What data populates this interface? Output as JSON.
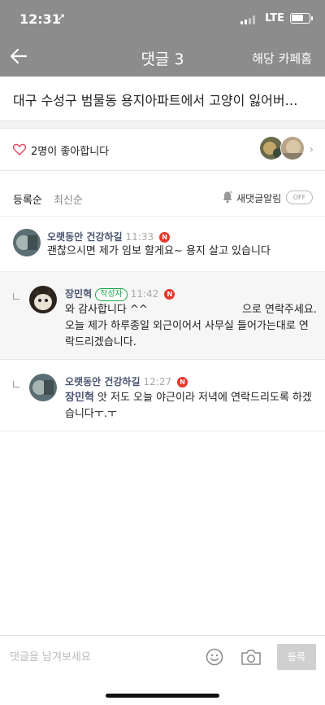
{
  "status_bar": {
    "time": "12:31",
    "network": "LTE"
  },
  "nav": {
    "title": "댓글 3",
    "cafe_home": "해당 카페홈"
  },
  "post": {
    "title": "대구 수성구 범물동 용지아파트에서 고양이 잃어버…"
  },
  "likes": {
    "text": "2명이 좋아합니다"
  },
  "sort": {
    "by_registration": "등록순",
    "latest": "최신순",
    "new_comment_alarm": "새댓글알림",
    "alarm_toggle": "OFF"
  },
  "comments": [
    {
      "nickname": "오랫동안 건강하길",
      "time": "11:33",
      "badge": "N",
      "text": "괜찮으시면 제가 임보 할게요~ 용지 살고 있습니다"
    },
    {
      "nickname": "장민혁",
      "writer_badge": "작성자",
      "time": "11:42",
      "badge": "N",
      "text_part1": "와 감사합니다 ^^",
      "text_part2": "으로 연락주세요. 오늘 제가 하루종일 외근이어서 사무실 들어가는대로 연락드리겠습니다."
    },
    {
      "nickname": "오랫동안 건강하길",
      "time": "12:27",
      "badge": "N",
      "mention": "장민혁",
      "text": "앗 저도 오늘 야근이라 저녁에 연락드리도록 하겠습니다ㅜ.ㅜ"
    }
  ],
  "input": {
    "placeholder": "댓글을 남겨보세요",
    "submit": "등록"
  },
  "colors": {
    "header_bg": "#8c8c8c",
    "nickname": "#4a5570",
    "writer_badge": "#1fa64a",
    "new_badge": "#e8372c"
  },
  "icons": [
    "back-arrow-icon",
    "heart-icon",
    "chevron-right-icon",
    "bell-icon",
    "emoji-icon",
    "camera-icon"
  ]
}
